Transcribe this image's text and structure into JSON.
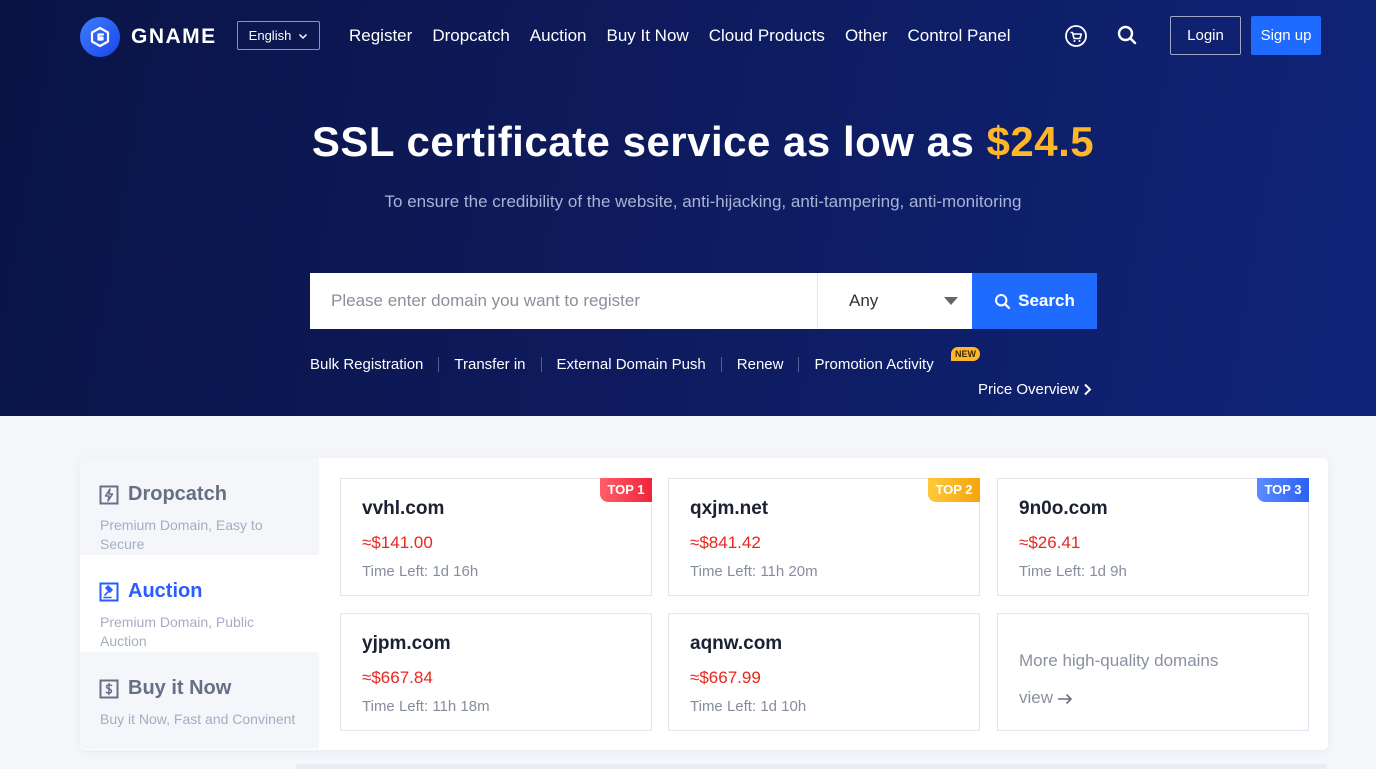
{
  "brand": {
    "name": "GNAME"
  },
  "language": {
    "selected": "English"
  },
  "nav": {
    "items": [
      "Register",
      "Dropcatch",
      "Auction",
      "Buy It Now",
      "Cloud Products",
      "Other",
      "Control Panel"
    ],
    "icons": [
      "cart-icon",
      "search-icon"
    ],
    "login": "Login",
    "signup": "Sign up"
  },
  "hero": {
    "title_prefix": "SSL certificate service as low as",
    "title_price": "$24.5",
    "subtitle": "To ensure the credibility of the website, anti-hijacking, anti-tampering, anti-monitoring"
  },
  "search": {
    "placeholder": "Please enter domain you want to register",
    "value": "",
    "select_value": "Any",
    "button": "Search"
  },
  "quick_links": [
    "Bulk Registration",
    "Transfer in",
    "External Domain Push",
    "Renew",
    "Promotion Activity"
  ],
  "new_badge": "NEW",
  "price_overview": "Price Overview",
  "tabs": [
    {
      "title": "Dropcatch",
      "desc": "Premium Domain, Easy to Secure",
      "icon": "lightning-icon"
    },
    {
      "title": "Auction",
      "desc": "Premium Domain, Public Auction",
      "icon": "gavel-icon"
    },
    {
      "title": "Buy it Now",
      "desc": "Buy it Now, Fast and Convinent",
      "icon": "dollar-icon"
    }
  ],
  "active_tab": "Auction",
  "domains": [
    {
      "name": "vvhl.com",
      "price": "≈$141.00",
      "time_label": "Time Left:",
      "time": "1d 16h",
      "badge": "TOP 1"
    },
    {
      "name": "qxjm.net",
      "price": "≈$841.42",
      "time_label": "Time Left:",
      "time": "11h 20m",
      "badge": "TOP 2"
    },
    {
      "name": "9n0o.com",
      "price": "≈$26.41",
      "time_label": "Time Left:",
      "time": "1d 9h",
      "badge": "TOP 3"
    },
    {
      "name": "yjpm.com",
      "price": "≈$667.84",
      "time_label": "Time Left:",
      "time": "11h 18m",
      "badge": ""
    },
    {
      "name": "aqnw.com",
      "price": "≈$667.99",
      "time_label": "Time Left:",
      "time": "1d 10h",
      "badge": ""
    }
  ],
  "more": {
    "text": "More high-quality domains",
    "link": "view"
  },
  "colors": {
    "accent": "#1f6bff",
    "price_red": "#e8271f",
    "gold": "#ffb629",
    "hero_bg": "#0e1a5c"
  }
}
